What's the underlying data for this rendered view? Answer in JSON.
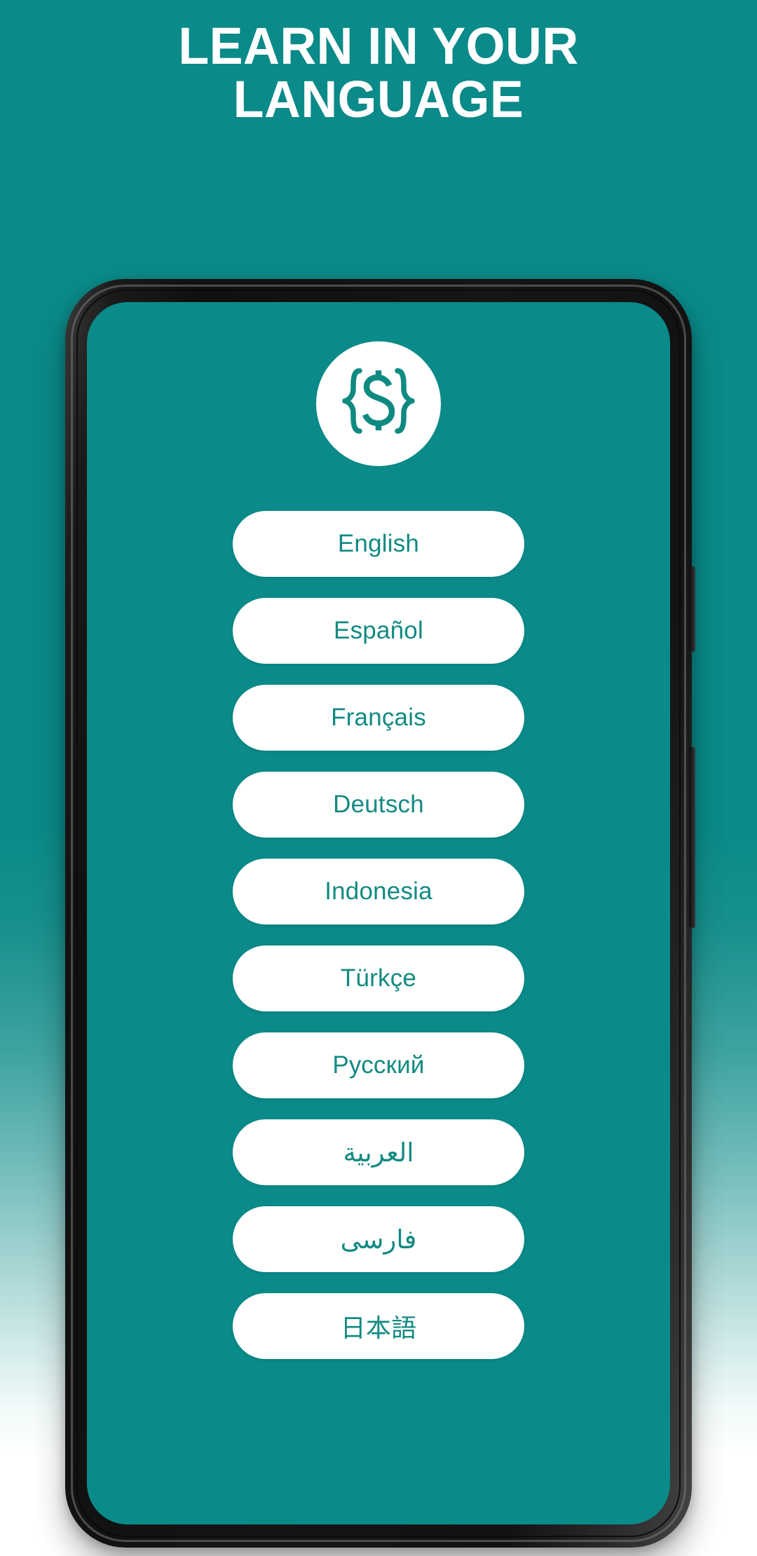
{
  "theme": {
    "background_teal": "#0a8a89",
    "accent_text_teal": "#128a82",
    "headline_color": "#ffffff",
    "pill_background": "#ffffff",
    "phone_frame": "#131313"
  },
  "headline": {
    "line1": "LEARN IN YOUR",
    "line2": "LANGUAGE",
    "full_text": "LEARN IN YOUR LANGUAGE"
  },
  "phone": {
    "side_keys": [
      {
        "name": "power-key"
      },
      {
        "name": "volume-key"
      }
    ]
  },
  "app": {
    "logo": {
      "icon_name": "currency-braces-logo",
      "glyph": "{ $ }",
      "circle_color": "#ffffff",
      "mark_color": "#0f8a81"
    },
    "language_list": {
      "items": [
        {
          "label": "English",
          "icon_name": "language-option-english",
          "dir": "ltr"
        },
        {
          "label": "Español",
          "icon_name": "language-option-spanish",
          "dir": "ltr"
        },
        {
          "label": "Français",
          "icon_name": "language-option-french",
          "dir": "ltr"
        },
        {
          "label": "Deutsch",
          "icon_name": "language-option-german",
          "dir": "ltr"
        },
        {
          "label": "Indonesia",
          "icon_name": "language-option-indonesian",
          "dir": "ltr"
        },
        {
          "label": "Türkçe",
          "icon_name": "language-option-turkish",
          "dir": "ltr"
        },
        {
          "label": "Русский",
          "icon_name": "language-option-russian",
          "dir": "ltr"
        },
        {
          "label": "العربية",
          "icon_name": "language-option-arabic",
          "dir": "rtl"
        },
        {
          "label": "فارسی",
          "icon_name": "language-option-persian",
          "dir": "rtl"
        },
        {
          "label": "日本語",
          "icon_name": "language-option-japanese",
          "dir": "cjk"
        }
      ]
    }
  }
}
